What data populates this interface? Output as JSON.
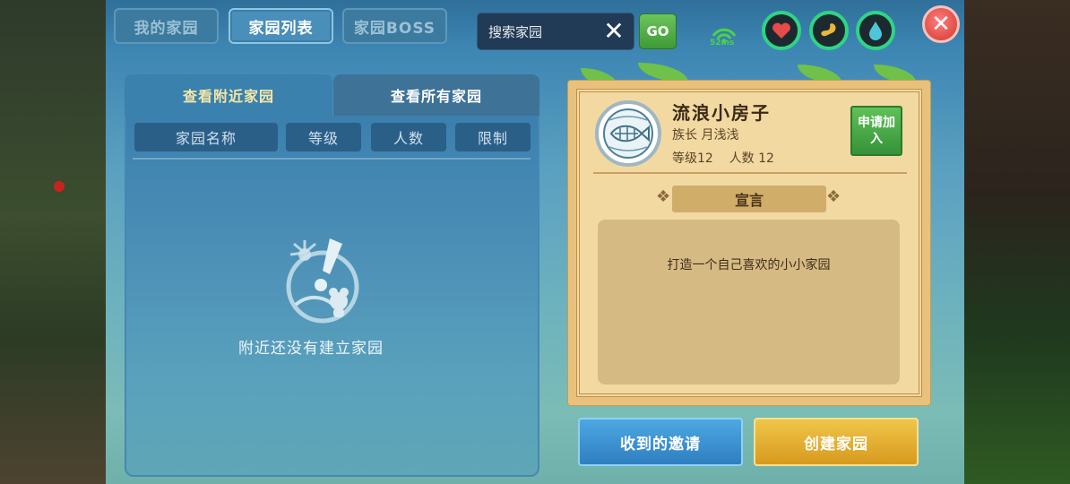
{
  "top_tabs": [
    {
      "label": "我的家园",
      "active": false
    },
    {
      "label": "家园列表",
      "active": true
    },
    {
      "label": "家园BOSS",
      "active": false
    }
  ],
  "search": {
    "placeholder": "搜索家园",
    "go_label": "GO"
  },
  "network": {
    "ping": "52ms"
  },
  "status_icons": [
    "heart-icon",
    "stomach-icon",
    "water-drop-icon"
  ],
  "list_tabs": [
    {
      "label": "查看附近家园",
      "active": true
    },
    {
      "label": "查看所有家园",
      "active": false
    }
  ],
  "columns": [
    "家园名称",
    "等级",
    "人数",
    "限制"
  ],
  "empty_message": "附近还没有建立家园",
  "home": {
    "name": "流浪小房子",
    "leader": "族长 月浅浅",
    "stats": "等级12    人数 12",
    "apply_label": "申请加入",
    "declaration_title": "宣言",
    "declaration": "打造一个自己喜欢的小小家园"
  },
  "buttons": {
    "invites": "收到的邀请",
    "create": "创建家园"
  },
  "colors": {
    "accent_green": "#2fd486",
    "panel_blue": "#3b7fae",
    "card_tan": "#e8c27d",
    "close_red": "#d2382f"
  }
}
